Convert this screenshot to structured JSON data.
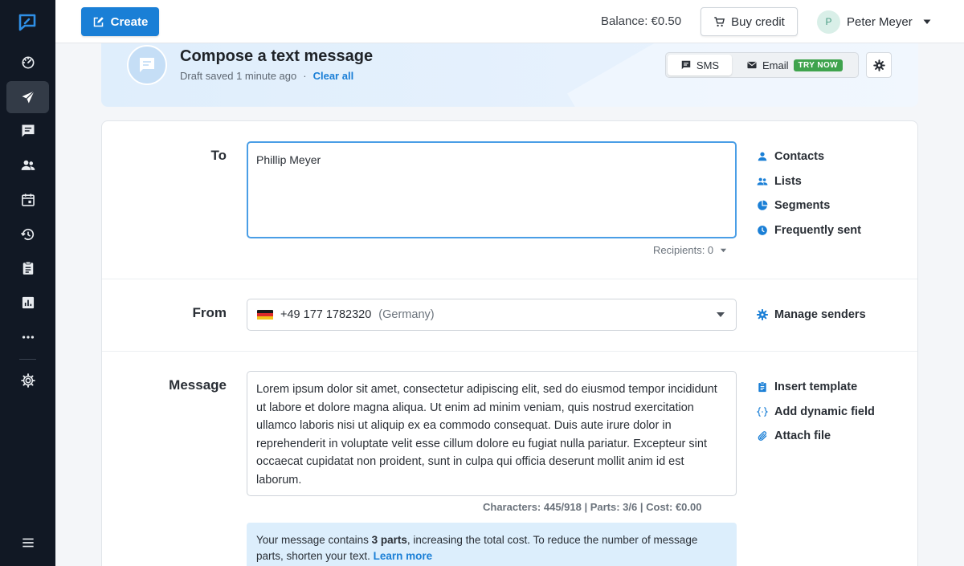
{
  "topbar": {
    "create_label": "Create",
    "balance_text": "Balance: €0.50",
    "buy_credit_label": "Buy credit",
    "user_initial": "P",
    "user_name": "Peter Meyer"
  },
  "sidebar": {
    "items": [
      {
        "icon": "dashboard-icon"
      },
      {
        "icon": "send-icon",
        "active": true
      },
      {
        "icon": "chat-icon"
      },
      {
        "icon": "contacts-icon"
      },
      {
        "icon": "calendar-icon"
      },
      {
        "icon": "history-icon"
      },
      {
        "icon": "clipboard-icon"
      },
      {
        "icon": "analytics-icon"
      },
      {
        "icon": "more-icon"
      },
      {
        "icon": "settings-icon"
      },
      {
        "icon": "menu-icon"
      }
    ]
  },
  "banner": {
    "title": "Compose a text message",
    "draft_status": "Draft saved 1 minute ago",
    "separator": "·",
    "clear_label": "Clear all",
    "sms_label": "SMS",
    "email_label": "Email",
    "try_now_label": "TRY NOW"
  },
  "form": {
    "to_label": "To",
    "to_value": "Phillip Meyer",
    "recipients_text": "Recipients: 0",
    "to_links": [
      "Contacts",
      "Lists",
      "Segments",
      "Frequently sent"
    ],
    "from_label": "From",
    "from_number": "+49 177 1782320",
    "from_country": "(Germany)",
    "from_link": "Manage senders",
    "message_label": "Message",
    "message_text": "Lorem ipsum dolor sit amet, consectetur adipiscing elit, sed do eiusmod tempor incididunt ut labore et dolore magna aliqua. Ut enim ad minim veniam, quis nostrud exercitation ullamco laboris nisi ut aliquip ex ea commodo consequat. Duis aute irure dolor in reprehenderit in voluptate velit esse cillum dolore eu fugiat nulla pariatur. Excepteur sint occaecat cupidatat non proident, sunt in culpa qui officia deserunt mollit anim id est laborum.",
    "message_links": [
      "Insert template",
      "Add dynamic field",
      "Attach file"
    ],
    "counts_text": "Characters: 445/918  |  Parts: 3/6  |  Cost: €0.00",
    "notice_prefix": "Your message contains ",
    "notice_bold": "3 parts",
    "notice_suffix": ", increasing the total cost. To reduce the number of message parts, shorten your text. ",
    "notice_link": "Learn more"
  },
  "colors": {
    "accent": "#1a7fd6",
    "sidebar_bg": "#111824",
    "try_now": "#3fa34d"
  }
}
